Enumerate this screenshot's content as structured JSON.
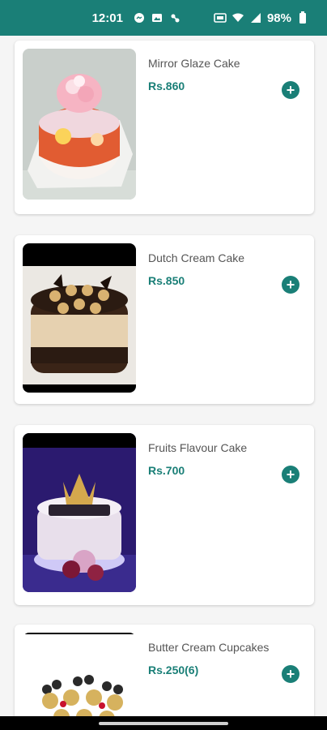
{
  "status_bar": {
    "time": "12:01",
    "battery": "98%",
    "icons": [
      "messenger-icon",
      "image-icon",
      "ribbon-icon",
      "data-saver-icon",
      "wifi-icon",
      "signal-icon",
      "battery-icon"
    ]
  },
  "colors": {
    "accent": "#1a7f77",
    "price": "#1a7f77",
    "name": "#555555",
    "card": "#ffffff",
    "background": "#f5f5f5"
  },
  "products": [
    {
      "name": "Mirror Glaze Cake",
      "price": "Rs.860"
    },
    {
      "name": "Dutch Cream Cake",
      "price": "Rs.850"
    },
    {
      "name": "Fruits Flavour Cake",
      "price": "Rs.700"
    },
    {
      "name": "Butter Cream Cupcakes",
      "price": "Rs.250(6)"
    }
  ],
  "add_button_icon": "plus-icon"
}
